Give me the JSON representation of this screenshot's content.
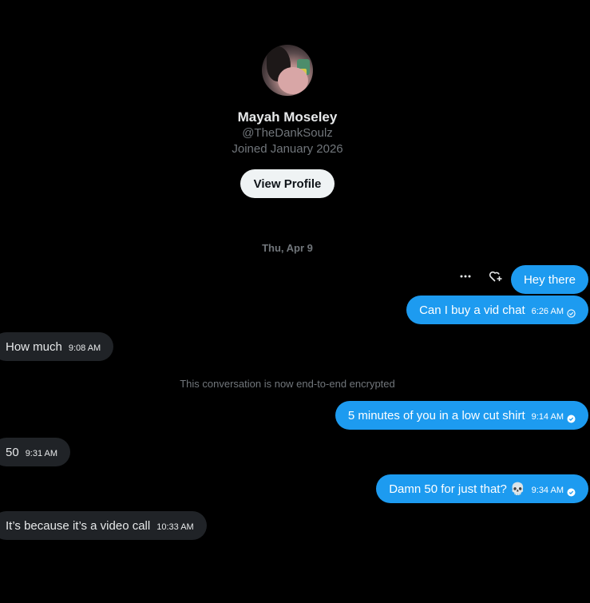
{
  "profile": {
    "display_name": "Mayah Moseley",
    "handle": "@TheDankSoulz",
    "joined": "Joined January 2026",
    "view_profile_label": "View Profile"
  },
  "conversation": {
    "date_separator": "Thu, Apr 9",
    "encryption_notice": "This conversation is now end-to-end encrypted",
    "messages": [
      {
        "direction": "out",
        "text": "Hey there",
        "time": ""
      },
      {
        "direction": "out",
        "text": "Can I buy a vid chat",
        "time": "6:26 AM",
        "status": "sent"
      },
      {
        "direction": "in",
        "text": "How much",
        "time": "9:08 AM"
      },
      {
        "direction": "out",
        "text": "5 minutes of you in a low cut shirt",
        "time": "9:14 AM",
        "status": "read"
      },
      {
        "direction": "in",
        "text": "50",
        "time": "9:31 AM"
      },
      {
        "direction": "out",
        "text": "Damn 50 for just that? 💀",
        "time": "9:34 AM",
        "status": "read"
      },
      {
        "direction": "in",
        "text": "It’s because it’s a video call",
        "time": "10:33 AM"
      }
    ]
  },
  "message_actions": {
    "more_icon": "more-horizontal-icon",
    "react_icon": "heart-plus-icon"
  },
  "colors": {
    "background": "#000000",
    "outgoing_bubble": "#1d9bf0",
    "incoming_bubble": "#202327",
    "muted_text": "#71767b",
    "button_bg": "#eff3f4"
  }
}
